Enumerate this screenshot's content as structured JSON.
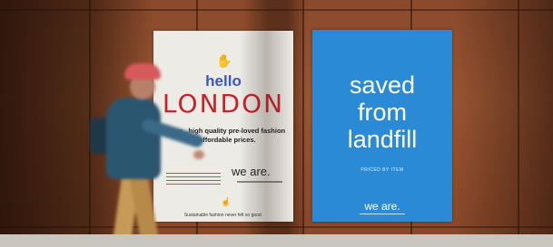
{
  "white_poster": {
    "icon": "hand-heart-icon",
    "hello": "hello",
    "city": "LONDON",
    "tagline": "we are...high quality pre-loved fashion at affordable prices.",
    "brand": "we are.",
    "footer": "Sustainable fashion never felt so good.",
    "accent_color": "#c7212a",
    "text_color": "#3b56c9"
  },
  "blue_poster": {
    "title_line1": "saved",
    "title_line2": "from",
    "title_line3": "landfill",
    "sub": "PRICED BY ITEM",
    "brand": "we are.",
    "color": "#2b8ad6"
  }
}
